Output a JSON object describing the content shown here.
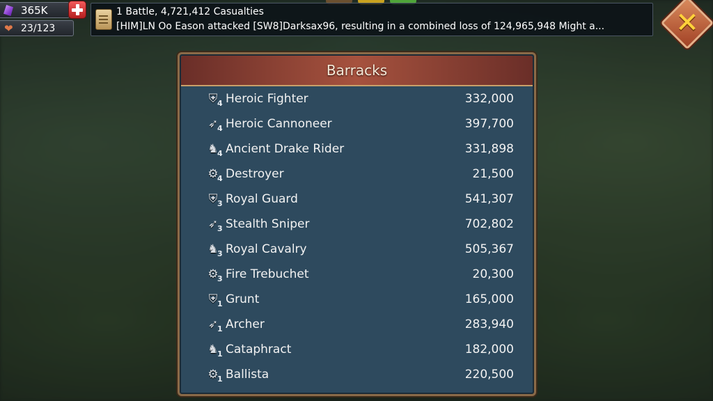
{
  "resources": {
    "gems": "365K",
    "stamina": "23/123"
  },
  "ticker": {
    "line1": "1 Battle, 4,721,412 Casualties",
    "line2": "[HIM]LN Oo Eason attacked [SW8]Darksax96, resulting in a combined loss of 124,965,948 Might a..."
  },
  "panel": {
    "title": "Barracks"
  },
  "troops": [
    {
      "icon": "shield-icon",
      "tier": "4",
      "name": "Heroic Fighter",
      "count": "332,000"
    },
    {
      "icon": "bow-icon",
      "tier": "4",
      "name": "Heroic Cannoneer",
      "count": "397,700"
    },
    {
      "icon": "horse-icon",
      "tier": "4",
      "name": "Ancient Drake Rider",
      "count": "331,898"
    },
    {
      "icon": "catapult-icon",
      "tier": "4",
      "name": "Destroyer",
      "count": "21,500"
    },
    {
      "icon": "shield-icon",
      "tier": "3",
      "name": "Royal Guard",
      "count": "541,307"
    },
    {
      "icon": "bow-icon",
      "tier": "3",
      "name": "Stealth Sniper",
      "count": "702,802"
    },
    {
      "icon": "horse-icon",
      "tier": "3",
      "name": "Royal Cavalry",
      "count": "505,367"
    },
    {
      "icon": "catapult-icon",
      "tier": "3",
      "name": "Fire Trebuchet",
      "count": "20,300"
    },
    {
      "icon": "shield-icon",
      "tier": "1",
      "name": "Grunt",
      "count": "165,000"
    },
    {
      "icon": "bow-icon",
      "tier": "1",
      "name": "Archer",
      "count": "283,940"
    },
    {
      "icon": "horse-icon",
      "tier": "1",
      "name": "Cataphract",
      "count": "182,000"
    },
    {
      "icon": "catapult-icon",
      "tier": "1",
      "name": "Ballista",
      "count": "220,500"
    }
  ],
  "colors": {
    "panel_bg": "#2e4a5e",
    "header_bg": "#a6523e",
    "close_x": "#ffd23a"
  }
}
